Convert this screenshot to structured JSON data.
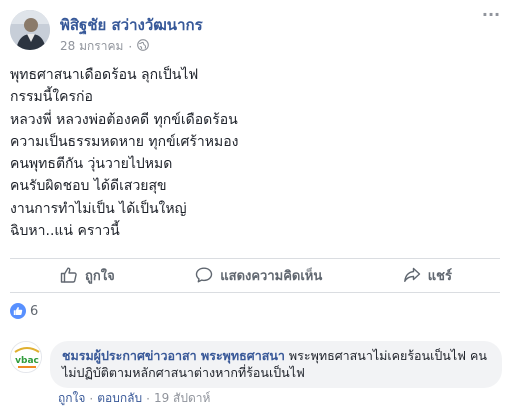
{
  "post": {
    "author": "พิสิฐชัย สว่างวัฒนากร",
    "date": "28 มกราคม",
    "privacy_icon": "globe-icon",
    "lines": [
      "พุทธศาสนาเดือดร้อน ลุกเป็นไฟ",
      "กรรมนี้ใครก่อ",
      "หลวงพี่ หลวงพ่อต้องคดี ทุกข์เดือดร้อน",
      "ความเป็นธรรมหดหาย ทุกข์เศร้าหมอง",
      "คนพุทธตีกัน วุ่นวายไปหมด",
      "คนรับผิดชอบ ได้ดีเสวยสุข",
      "งานการทำไม่เป็น ได้เป็นใหญ่",
      "ฉิบหา..แน่ คราวนี้"
    ]
  },
  "actions": {
    "like": "ถูกใจ",
    "comment": "แสดงความคิดเห็น",
    "share": "แชร์"
  },
  "reactions": {
    "count": "6",
    "color": "#5890ff"
  },
  "comment": {
    "author": "ชมรมผู้ประกาศข่าวอาสา พระพุทธศาสนา",
    "text": "พระพุทธศาสนาไม่เคยร้อนเป็นไฟ คนไม่ปฏิบัติตามหลักศาสนาต่างหากที่ร้อนเป็นไฟ",
    "avatar_text": "vbac",
    "like": "ถูกใจ",
    "reply": "ตอบกลับ",
    "time": "19 สัปดาห์",
    "separator": "·"
  },
  "colors": {
    "link": "#365899",
    "muted": "#90949c",
    "text": "#1d2129"
  }
}
